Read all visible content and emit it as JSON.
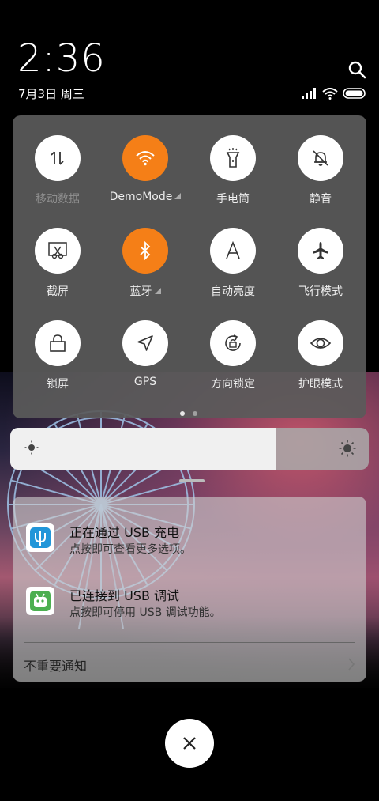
{
  "header": {
    "time": "2:36",
    "date": "7月3日 周三"
  },
  "tiles": [
    {
      "label": "移动数据",
      "icon": "mobile-data-icon",
      "active": false
    },
    {
      "label": "DemoMode",
      "icon": "wifi-icon",
      "active": true,
      "has_caret": true
    },
    {
      "label": "手电筒",
      "icon": "flashlight-icon",
      "active": false
    },
    {
      "label": "静音",
      "icon": "mute-bell-icon",
      "active": false
    },
    {
      "label": "截屏",
      "icon": "screenshot-icon",
      "active": false
    },
    {
      "label": "蓝牙",
      "icon": "bluetooth-icon",
      "active": true,
      "has_caret": true
    },
    {
      "label": "自动亮度",
      "icon": "auto-brightness-icon",
      "active": false
    },
    {
      "label": "飞行模式",
      "icon": "airplane-icon",
      "active": false
    },
    {
      "label": "锁屏",
      "icon": "lock-icon",
      "active": false
    },
    {
      "label": "GPS",
      "icon": "gps-icon",
      "active": false
    },
    {
      "label": "方向锁定",
      "icon": "rotation-lock-icon",
      "active": false
    },
    {
      "label": "护眼模式",
      "icon": "eye-icon",
      "active": false
    }
  ],
  "colors": {
    "active_tile": "#f57f17",
    "panel_bg": "#5a5a5a"
  },
  "brightness": {
    "level_fraction": 0.74
  },
  "notifications": [
    {
      "title": "正在通过 USB 充电",
      "body": "点按即可查看更多选项。",
      "icon": "usb-icon"
    },
    {
      "title": "已连接到 USB 调试",
      "body": "点按即可停用 USB 调试功能。",
      "icon": "android-debug-icon"
    }
  ],
  "unimportant_label": "不重要通知"
}
